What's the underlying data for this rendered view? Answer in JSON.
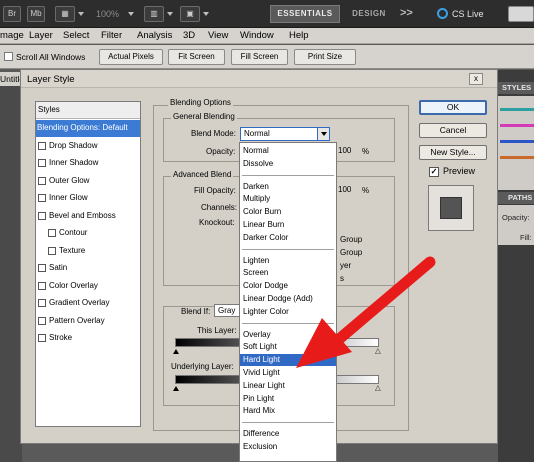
{
  "appbar": {
    "zoom": "100%",
    "workspace_active": "ESSENTIALS",
    "workspace_other": "DESIGN",
    "more": ">>",
    "cslive": "CS Live"
  },
  "menu": [
    "mage",
    "Layer",
    "Select",
    "Filter",
    "Analysis",
    "3D",
    "View",
    "Window",
    "Help"
  ],
  "options_bar": {
    "scroll_all_windows": "Scroll All Windows",
    "buttons": [
      "Actual Pixels",
      "Fit Screen",
      "Fill Screen",
      "Print Size"
    ]
  },
  "doc_tab": "Untitled",
  "right_panels": {
    "styles": "STYLES",
    "paths": "PATHS",
    "opacity": "Opacity:",
    "fill": "Fill:"
  },
  "dialog": {
    "title": "Layer Style",
    "close": "x",
    "styles_header": "Styles",
    "style_items": [
      {
        "label": "Blending Options: Default",
        "selected": true,
        "checkbox": false,
        "indent": 0
      },
      {
        "label": "Drop Shadow",
        "checkbox": true,
        "indent": 0
      },
      {
        "label": "Inner Shadow",
        "checkbox": true,
        "indent": 0
      },
      {
        "label": "Outer Glow",
        "checkbox": true,
        "indent": 0
      },
      {
        "label": "Inner Glow",
        "checkbox": true,
        "indent": 0
      },
      {
        "label": "Bevel and Emboss",
        "checkbox": true,
        "indent": 0
      },
      {
        "label": "Contour",
        "checkbox": true,
        "indent": 1
      },
      {
        "label": "Texture",
        "checkbox": true,
        "indent": 1
      },
      {
        "label": "Satin",
        "checkbox": true,
        "indent": 0
      },
      {
        "label": "Color Overlay",
        "checkbox": true,
        "indent": 0
      },
      {
        "label": "Gradient Overlay",
        "checkbox": true,
        "indent": 0
      },
      {
        "label": "Pattern Overlay",
        "checkbox": true,
        "indent": 0
      },
      {
        "label": "Stroke",
        "checkbox": true,
        "indent": 0
      }
    ],
    "blending_options": "Blending Options",
    "general_blending": "General Blending",
    "blend_mode_label": "Blend Mode:",
    "blend_mode_value": "Normal",
    "opacity_label": "Opacity:",
    "opacity_value": "100",
    "percent": "%",
    "advanced_blending": "Advanced Blend",
    "fill_opacity_label": "Fill Opacity:",
    "fill_opacity_value": "100",
    "channels_label": "Channels:",
    "knockout_label": "Knockout:",
    "partial_right": [
      "Group",
      "Group",
      "yer",
      "s"
    ],
    "blend_if_label": "Blend If:",
    "blend_if_value": "Gray",
    "this_layer_label": "This Layer:",
    "underlying_layer_label": "Underlying Layer:",
    "ok": "OK",
    "cancel": "Cancel",
    "new_style": "New Style...",
    "preview_label": "Preview",
    "preview_checked": "✓"
  },
  "blend_modes": [
    [
      "Normal",
      "Dissolve"
    ],
    [
      "Darken",
      "Multiply",
      "Color Burn",
      "Linear Burn",
      "Darker Color"
    ],
    [
      "Lighten",
      "Screen",
      "Color Dodge",
      "Linear Dodge (Add)",
      "Lighter Color"
    ],
    [
      "Overlay",
      "Soft Light",
      "Hard Light",
      "Vivid Light",
      "Linear Light",
      "Pin Light",
      "Hard Mix"
    ],
    [
      "Difference",
      "Exclusion"
    ]
  ],
  "highlighted_mode": "Hard Light",
  "arrow_color": "#e81b1b",
  "selection_color": "#316ac5"
}
